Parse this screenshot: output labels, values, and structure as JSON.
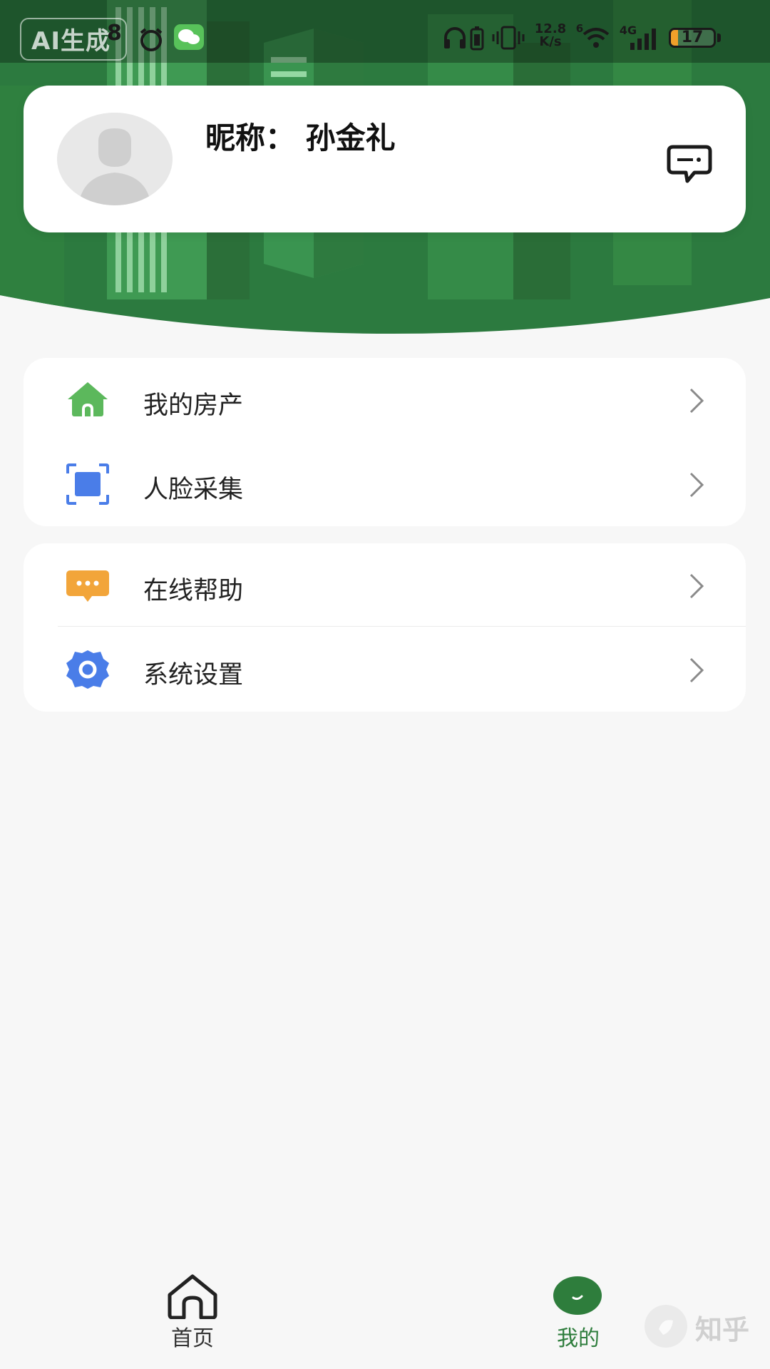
{
  "status_bar": {
    "ai_badge": "AI生成",
    "time_fragment": "8",
    "network_speed_value": "12.8",
    "network_speed_unit": "K/s",
    "wifi_level": "6",
    "cellular_type": "4G",
    "battery_level": "17",
    "battery_percent": 17,
    "icons": [
      "alarm-icon",
      "wechat-icon",
      "headphones-icon",
      "battery-saver-icon",
      "vibrate-icon",
      "wifi-icon",
      "signal-icon"
    ]
  },
  "profile": {
    "nickname": "昵称： 孙金礼",
    "message_icon": "message-icon"
  },
  "menu": {
    "group1": [
      {
        "label": "我的房产",
        "icon": "house-icon",
        "color": "#5cb85c"
      },
      {
        "label": "人脸采集",
        "icon": "face-scan-icon",
        "color": "#4a7de8"
      }
    ],
    "group2": [
      {
        "label": "在线帮助",
        "icon": "chat-bubble-icon",
        "color": "#f2a53a"
      },
      {
        "label": "系统设置",
        "icon": "gear-icon",
        "color": "#4a7de8"
      }
    ]
  },
  "bottom_nav": {
    "home_label": "首页",
    "mine_label": "我的",
    "active": "我的",
    "accent_color": "#2e7d3c"
  },
  "watermark": "知乎"
}
